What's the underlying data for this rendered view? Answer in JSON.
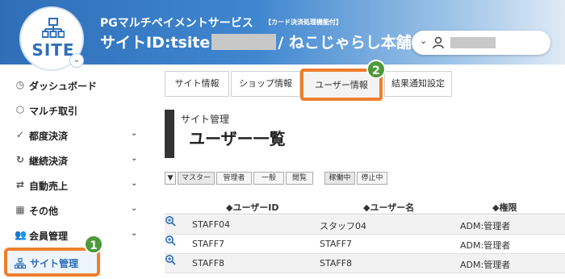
{
  "header": {
    "logo_text": "SITE",
    "service_name": "PGマルチペイメントサービス",
    "service_badge": "【カード決済処理機能付】",
    "site_id_prefix": "サイトID:tsite",
    "site_name": "/ ねこじゃらし本舗",
    "user_chevron": "⌄"
  },
  "sidebar": {
    "items": [
      {
        "label": "ダッシュボード",
        "icon": "dashboard-icon",
        "glyph": "◷",
        "has_chevron": false
      },
      {
        "label": "マルチ取引",
        "icon": "cube-icon",
        "glyph": "⬡",
        "has_chevron": false
      },
      {
        "label": "都度決済",
        "icon": "check-circle-icon",
        "glyph": "✓",
        "has_chevron": true
      },
      {
        "label": "継続決済",
        "icon": "refresh-icon",
        "glyph": "↻",
        "has_chevron": true
      },
      {
        "label": "自動売上",
        "icon": "exchange-icon",
        "glyph": "⇄",
        "has_chevron": true
      },
      {
        "label": "その他",
        "icon": "grid-icon",
        "glyph": "▦",
        "has_chevron": true
      },
      {
        "label": "会員管理",
        "icon": "users-icon",
        "glyph": "👥",
        "has_chevron": true
      }
    ],
    "active_item": {
      "label": "サイト管理",
      "icon": "sitemap-icon"
    },
    "chevron": "⌄"
  },
  "annotations": {
    "step1": "1",
    "step2": "2"
  },
  "tabs": [
    {
      "label": "サイト情報"
    },
    {
      "label": "ショップ情報"
    },
    {
      "label": "ユーザー情報",
      "active": true
    },
    {
      "label": "結果通知設定"
    }
  ],
  "page": {
    "section_label": "サイト管理",
    "title": "ユーザー一覧"
  },
  "filters": {
    "funnel": "▼",
    "roles": [
      "マスター",
      "管理者",
      "一般",
      "閲覧"
    ],
    "statuses": [
      "稼働中",
      "停止中"
    ]
  },
  "table": {
    "columns": [
      "◆ユーザーID",
      "◆ユーザー名",
      "◆権限"
    ],
    "rows": [
      {
        "id": "STAFF04",
        "name": "スタッフ04",
        "role": "ADM:管理者"
      },
      {
        "id": "STAFF7",
        "name": "STAFF7",
        "role": "ADM:管理者"
      },
      {
        "id": "STAFF8",
        "name": "STAFF8",
        "role": "ADM:管理者"
      }
    ]
  },
  "colors": {
    "header_blue": "#2f6fb8",
    "highlight_orange": "#ee7f2d",
    "badge_green": "#4c9a3a",
    "link_blue": "#2d6db5"
  }
}
